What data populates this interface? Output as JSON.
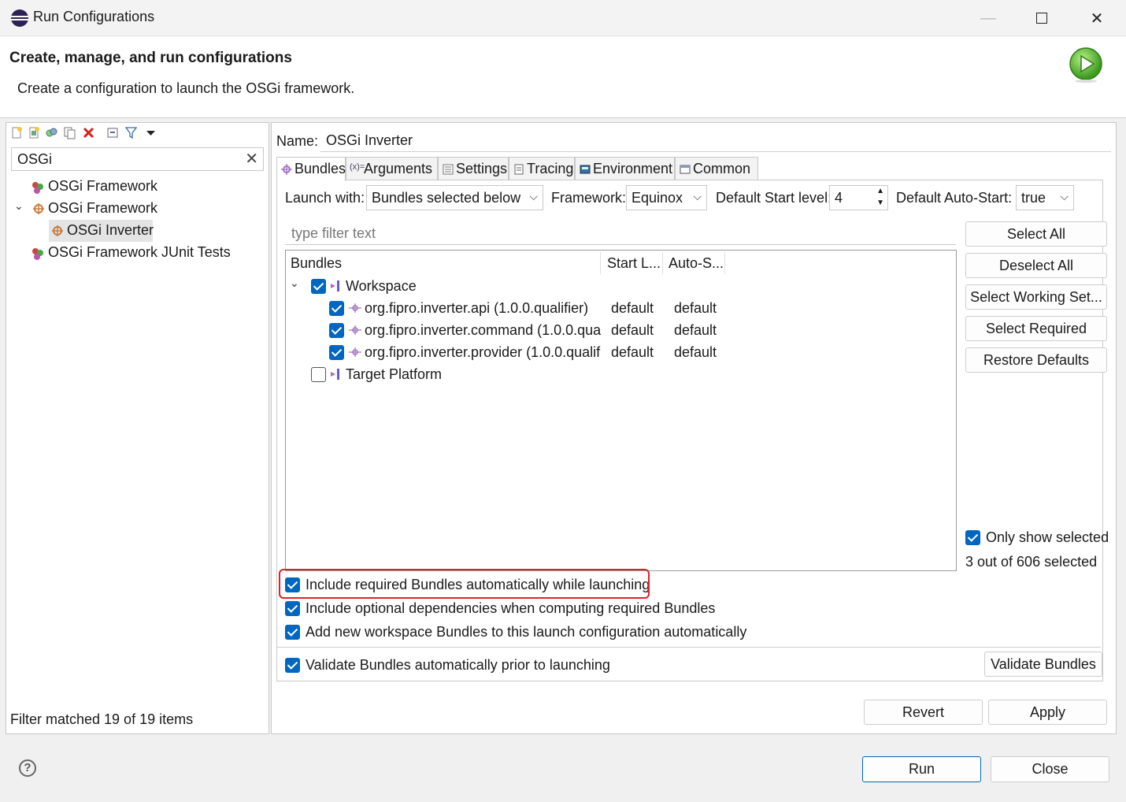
{
  "window": {
    "title": "Run Configurations"
  },
  "header": {
    "title": "Create, manage, and run configurations",
    "description": "Create a configuration to launch the OSGi framework."
  },
  "left": {
    "filter_value": "OSGi",
    "tree": [
      {
        "label": "OSGi Framework",
        "icon": "osgi-junit-icon",
        "level": 0
      },
      {
        "label": "OSGi Framework",
        "icon": "osgi-framework-icon",
        "level": 0,
        "expanded": true
      },
      {
        "label": "OSGi Inverter",
        "icon": "osgi-config-icon",
        "level": 1,
        "selected": true
      },
      {
        "label": "OSGi Framework JUnit Tests",
        "icon": "osgi-junit-icon",
        "level": 0
      }
    ],
    "status": "Filter matched 19 of 19 items"
  },
  "config": {
    "name_label": "Name:",
    "name_value": "OSGi Inverter",
    "tabs": [
      "Bundles",
      "Arguments",
      "Settings",
      "Tracing",
      "Environment",
      "Common"
    ],
    "active_tab": "Bundles",
    "launch_with_label": "Launch with:",
    "launch_with_value": "Bundles selected below",
    "framework_label": "Framework:",
    "framework_value": "Equinox",
    "start_level_label": "Default Start level:",
    "start_level_value": "4",
    "auto_start_label": "Default Auto-Start:",
    "auto_start_value": "true",
    "filter_placeholder": "type filter text",
    "table": {
      "columns": [
        "Bundles",
        "Start L...",
        "Auto-S..."
      ],
      "rows": [
        {
          "label": "Workspace",
          "checked": true,
          "group": true,
          "start": "",
          "auto": ""
        },
        {
          "label": "org.fipro.inverter.api (1.0.0.qualifier)",
          "checked": true,
          "group": false,
          "start": "default",
          "auto": "default"
        },
        {
          "label": "org.fipro.inverter.command (1.0.0.qua",
          "checked": true,
          "group": false,
          "start": "default",
          "auto": "default"
        },
        {
          "label": "org.fipro.inverter.provider (1.0.0.qualif",
          "checked": true,
          "group": false,
          "start": "default",
          "auto": "default"
        },
        {
          "label": "Target Platform",
          "checked": false,
          "group": true,
          "start": "",
          "auto": ""
        }
      ]
    },
    "side_buttons": [
      "Select All",
      "Deselect All",
      "Select Working Set...",
      "Select Required",
      "Restore Defaults"
    ],
    "only_show_selected": "Only show selected",
    "selected_count": "3 out of 606 selected",
    "options": [
      {
        "label": "Include required Bundles automatically while launching",
        "checked": true
      },
      {
        "label": "Include optional dependencies when computing required Bundles",
        "checked": true
      },
      {
        "label": "Add new workspace Bundles to this launch configuration automatically",
        "checked": true
      },
      {
        "label": "Validate Bundles automatically prior to launching",
        "checked": true
      }
    ],
    "validate_button": "Validate Bundles",
    "revert_button": "Revert",
    "apply_button": "Apply"
  },
  "footer": {
    "run_button": "Run",
    "close_button": "Close"
  },
  "colors": {
    "accent": "#0067c0",
    "highlight": "#e0202a"
  }
}
